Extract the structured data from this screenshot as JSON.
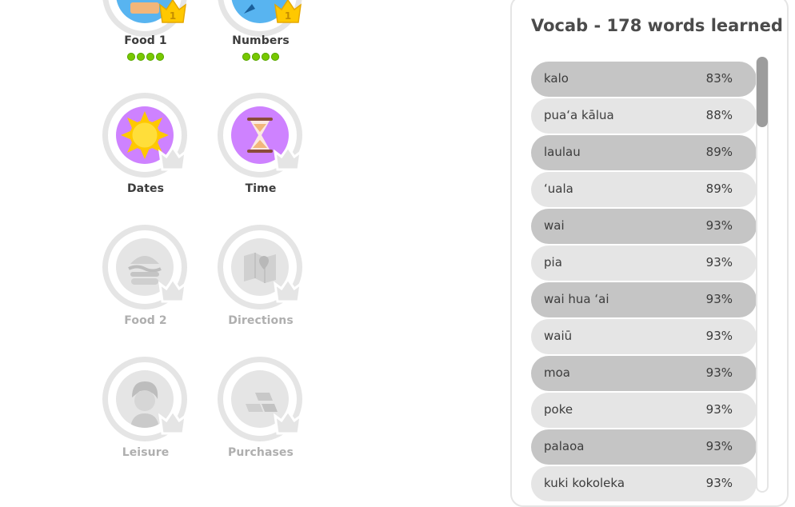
{
  "colors": {
    "unlocked_label": "#3c3c3c",
    "locked_label": "#afafaf",
    "purple_disc": "#ce82ff",
    "blue_disc": "#58b4f0",
    "gold_crown": "#ffc800",
    "locked_disc": "#e5e5e5",
    "row_dark": "#c5c5c5",
    "row_light": "#e5e5e5"
  },
  "skills": [
    {
      "label": "Food 1",
      "crown_level": "1",
      "state": "completed",
      "progress_dots": 4
    },
    {
      "label": "Numbers",
      "crown_level": "1",
      "state": "completed",
      "progress_dots": 4
    },
    {
      "label": "Dates",
      "state": "unlocked",
      "icon": "sun-icon"
    },
    {
      "label": "Time",
      "state": "unlocked",
      "icon": "hourglass-icon"
    },
    {
      "label": "Food 2",
      "state": "locked",
      "icon": "burger-icon"
    },
    {
      "label": "Directions",
      "state": "locked",
      "icon": "map-icon"
    },
    {
      "label": "Leisure",
      "state": "locked",
      "icon": "person-icon"
    },
    {
      "label": "Purchases",
      "state": "locked",
      "icon": "gold-bars-icon"
    }
  ],
  "vocab": {
    "title": "Vocab - 178 words learned",
    "words": [
      {
        "word": "kalo",
        "strength": "83%"
      },
      {
        "word": "puaʻa kālua",
        "strength": "88%"
      },
      {
        "word": "laulau",
        "strength": "89%"
      },
      {
        "word": "ʻuala",
        "strength": "89%"
      },
      {
        "word": "wai",
        "strength": "93%"
      },
      {
        "word": "pia",
        "strength": "93%"
      },
      {
        "word": "wai hua ʻai",
        "strength": "93%"
      },
      {
        "word": "waiū",
        "strength": "93%"
      },
      {
        "word": "moa",
        "strength": "93%"
      },
      {
        "word": "poke",
        "strength": "93%"
      },
      {
        "word": "palaoa",
        "strength": "93%"
      },
      {
        "word": "kuki kokoleka",
        "strength": "93%"
      }
    ]
  }
}
